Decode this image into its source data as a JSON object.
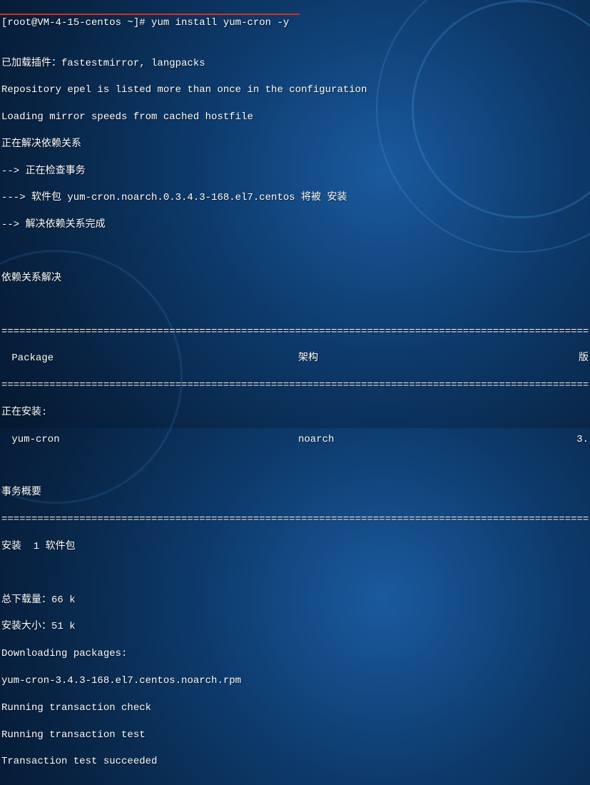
{
  "prompt": "[root@VM-4-15-centos ~]# ",
  "command": "yum install yum-cron -y",
  "lines": {
    "l1": "已加载插件：fastestmirror, langpacks",
    "l2": "Repository epel is listed more than once in the configuration",
    "l3": "Loading mirror speeds from cached hostfile",
    "l4": "正在解决依赖关系",
    "l5": "--> 正在检查事务",
    "l6": "---> 软件包 yum-cron.noarch.0.3.4.3-168.el7.centos 将被 安装",
    "l7": "--> 解决依赖关系完成",
    "l8": "依赖关系解决"
  },
  "separator": "================================================================================================================================",
  "table": {
    "hdr_pkg": " Package",
    "hdr_arch": "架构",
    "hdr_ver": "版",
    "installing": "正在安装:",
    "pkg_name": " yum-cron",
    "pkg_arch": "noarch",
    "pkg_ver": "3."
  },
  "summary": {
    "title": "事务概要",
    "install": "安装  1 软件包",
    "dl_size": "总下载量：66 k",
    "inst_size": "安装大小：51 k",
    "downloading": "Downloading packages:",
    "rpm": "yum-cron-3.4.3-168.el7.centos.noarch.rpm",
    "check": "Running transaction check",
    "test": "Running transaction test",
    "succeeded": "Transaction test succeeded"
  }
}
